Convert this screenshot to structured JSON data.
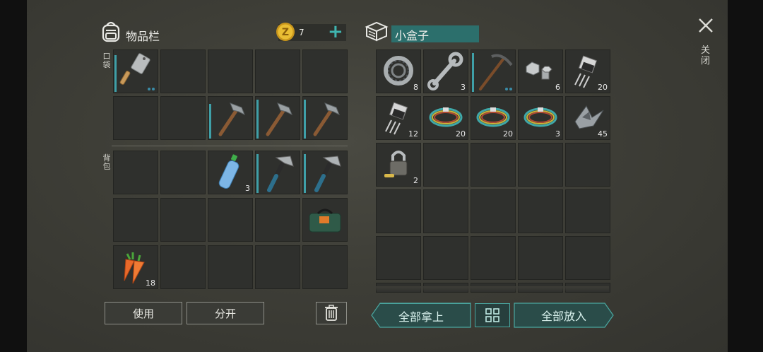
{
  "inventory": {
    "title": "物品栏",
    "pocket_label": "口袋",
    "backpack_label": "背包",
    "coin_count": "7",
    "add_symbol": "+"
  },
  "pocket_slots": [
    {
      "item": "cleaver",
      "qty": "",
      "durability": 0.9,
      "dots": true
    },
    {
      "item": "",
      "qty": ""
    },
    {
      "item": "",
      "qty": ""
    },
    {
      "item": "",
      "qty": ""
    },
    {
      "item": "",
      "qty": ""
    },
    {
      "item": "",
      "qty": ""
    },
    {
      "item": "",
      "qty": ""
    },
    {
      "item": "hammer",
      "qty": "",
      "durability": 0.85
    },
    {
      "item": "hammer",
      "qty": "",
      "durability": 0.95
    },
    {
      "item": "hammer",
      "qty": "",
      "durability": 0.95
    }
  ],
  "backpack_slots": [
    {
      "item": "",
      "qty": ""
    },
    {
      "item": "",
      "qty": ""
    },
    {
      "item": "water-bottle",
      "qty": "3"
    },
    {
      "item": "hatchet",
      "qty": "",
      "durability": 0.95
    },
    {
      "item": "hatchet",
      "qty": "",
      "durability": 0.95
    },
    {
      "item": "",
      "qty": ""
    },
    {
      "item": "",
      "qty": ""
    },
    {
      "item": "",
      "qty": ""
    },
    {
      "item": "",
      "qty": ""
    },
    {
      "item": "toolbag",
      "qty": ""
    },
    {
      "item": "carrots",
      "qty": "18"
    },
    {
      "item": "",
      "qty": ""
    },
    {
      "item": "",
      "qty": ""
    },
    {
      "item": "",
      "qty": ""
    },
    {
      "item": "",
      "qty": ""
    }
  ],
  "container": {
    "name": "小盒子",
    "slots": [
      {
        "item": "bearing",
        "qty": "8"
      },
      {
        "item": "wrench",
        "qty": "3"
      },
      {
        "item": "pickaxe",
        "qty": "",
        "durability": 0.95,
        "dots": true
      },
      {
        "item": "bolt-nut",
        "qty": "6"
      },
      {
        "item": "transistor",
        "qty": "20"
      },
      {
        "item": "transistor",
        "qty": "12"
      },
      {
        "item": "wire",
        "qty": "20"
      },
      {
        "item": "wire",
        "qty": "20"
      },
      {
        "item": "wire",
        "qty": "3"
      },
      {
        "item": "scrap-metal",
        "qty": "45"
      },
      {
        "item": "padlock",
        "qty": "2"
      },
      {
        "item": "",
        "qty": ""
      },
      {
        "item": "",
        "qty": ""
      },
      {
        "item": "",
        "qty": ""
      },
      {
        "item": "",
        "qty": ""
      }
    ]
  },
  "buttons": {
    "use": "使用",
    "split": "分开",
    "take_all": "全部拿上",
    "put_all": "全部放入"
  },
  "close_label": "关闭",
  "colors": {
    "accent": "#3fa0a8",
    "button_teal": "#2a4c49",
    "coin": "#e1b52c"
  }
}
